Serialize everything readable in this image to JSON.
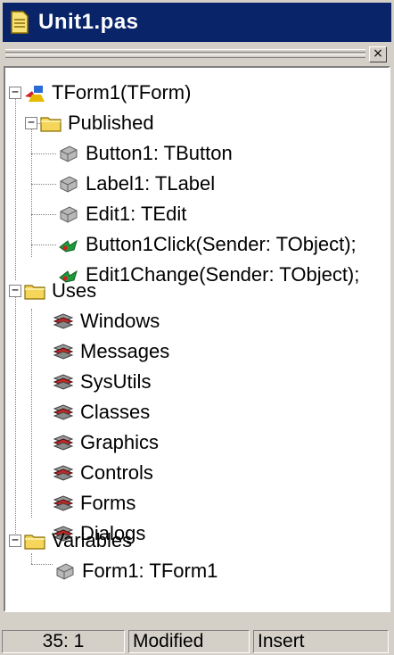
{
  "window": {
    "title": "Unit1.pas",
    "close_glyph": "×",
    "title_icon": "document-icon",
    "title_bar_color": "#0a246a"
  },
  "tree": [
    {
      "key": "tform1",
      "label": "TForm1(TForm)",
      "icon": "form-class-icon",
      "expanded": true
    },
    {
      "key": "published",
      "label": "Published",
      "icon": "folder-icon",
      "expanded": true
    },
    {
      "key": "button1",
      "label": "Button1: TButton",
      "icon": "field-icon"
    },
    {
      "key": "label1",
      "label": "Label1: TLabel",
      "icon": "field-icon"
    },
    {
      "key": "edit1",
      "label": "Edit1: TEdit",
      "icon": "field-icon"
    },
    {
      "key": "button1click",
      "label": "Button1Click(Sender: TObject);",
      "icon": "method-icon"
    },
    {
      "key": "edit1change",
      "label": "Edit1Change(Sender: TObject);",
      "icon": "method-icon"
    },
    {
      "key": "uses",
      "label": "Uses",
      "icon": "folder-icon",
      "expanded": true
    },
    {
      "key": "windows",
      "label": "Windows",
      "icon": "unit-icon"
    },
    {
      "key": "messages",
      "label": "Messages",
      "icon": "unit-icon"
    },
    {
      "key": "sysutils",
      "label": "SysUtils",
      "icon": "unit-icon"
    },
    {
      "key": "classes",
      "label": "Classes",
      "icon": "unit-icon"
    },
    {
      "key": "graphics",
      "label": "Graphics",
      "icon": "unit-icon"
    },
    {
      "key": "controls",
      "label": "Controls",
      "icon": "unit-icon"
    },
    {
      "key": "forms",
      "label": "Forms",
      "icon": "unit-icon"
    },
    {
      "key": "dialogs",
      "label": "Dialogs",
      "icon": "unit-icon"
    },
    {
      "key": "variables",
      "label": "Variables",
      "icon": "folder-icon",
      "expanded": true
    },
    {
      "key": "form1",
      "label": "Form1: TForm1",
      "icon": "field-icon"
    }
  ],
  "expander_glyph": "−",
  "status": {
    "position": "35:  1",
    "modified": "Modified",
    "mode": "Insert"
  }
}
